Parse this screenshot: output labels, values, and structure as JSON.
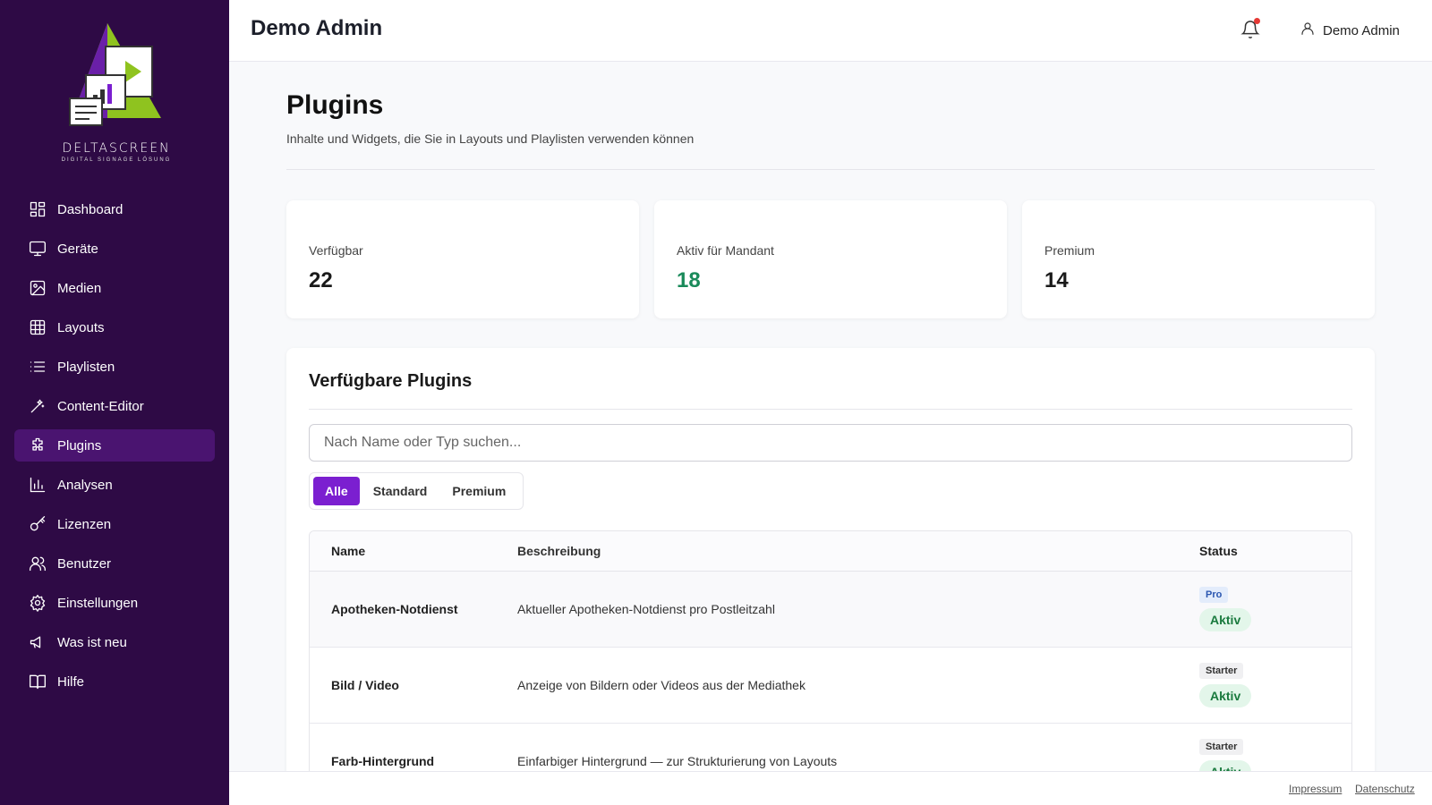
{
  "brand": {
    "name": "DELTASCREEN",
    "tagline": "DIGITAL SIGNAGE LÖSUNG",
    "colors": {
      "sidebar": "#2e0a45",
      "accent": "#7b1fd0",
      "active_nav": "#4a1470",
      "success": "#1a8a5a"
    }
  },
  "sidebar": {
    "items": [
      {
        "label": "Dashboard",
        "icon": "dashboard-icon"
      },
      {
        "label": "Geräte",
        "icon": "monitor-icon"
      },
      {
        "label": "Medien",
        "icon": "image-icon"
      },
      {
        "label": "Layouts",
        "icon": "grid-icon"
      },
      {
        "label": "Playlisten",
        "icon": "list-icon"
      },
      {
        "label": "Content-Editor",
        "icon": "magic-wand-icon"
      },
      {
        "label": "Plugins",
        "icon": "puzzle-icon",
        "active": true
      },
      {
        "label": "Analysen",
        "icon": "bar-chart-icon"
      },
      {
        "label": "Lizenzen",
        "icon": "key-icon"
      },
      {
        "label": "Benutzer",
        "icon": "users-icon"
      },
      {
        "label": "Einstellungen",
        "icon": "gear-icon"
      },
      {
        "label": "Was ist neu",
        "icon": "megaphone-icon"
      },
      {
        "label": "Hilfe",
        "icon": "book-icon"
      }
    ]
  },
  "header": {
    "title": "Demo Admin",
    "user_name": "Demo Admin",
    "has_notification": true
  },
  "page": {
    "title": "Plugins",
    "subtitle": "Inhalte und Widgets, die Sie in Layouts und Playlisten verwenden können"
  },
  "stats": [
    {
      "label": "Verfügbar",
      "value": "22"
    },
    {
      "label": "Aktiv für Mandant",
      "value": "18"
    },
    {
      "label": "Premium",
      "value": "14"
    }
  ],
  "plugins_card": {
    "title": "Verfügbare Plugins",
    "search_placeholder": "Nach Name oder Typ suchen...",
    "filters": [
      {
        "label": "Alle",
        "active": true
      },
      {
        "label": "Standard"
      },
      {
        "label": "Premium"
      }
    ],
    "columns": [
      "Name",
      "Beschreibung",
      "Status"
    ],
    "rows": [
      {
        "name": "Apotheken-Notdienst",
        "description": "Aktueller Apotheken-Notdienst pro Postleitzahl",
        "tier": "Pro",
        "status": "Aktiv"
      },
      {
        "name": "Bild / Video",
        "description": "Anzeige von Bildern oder Videos aus der Mediathek",
        "tier": "Starter",
        "status": "Aktiv"
      },
      {
        "name": "Farb-Hintergrund",
        "description": "Einfarbiger Hintergrund — zur Strukturierung von Layouts",
        "tier": "Starter",
        "status": "Aktiv"
      }
    ]
  },
  "footer": {
    "links": [
      "Impressum",
      "Datenschutz"
    ]
  }
}
